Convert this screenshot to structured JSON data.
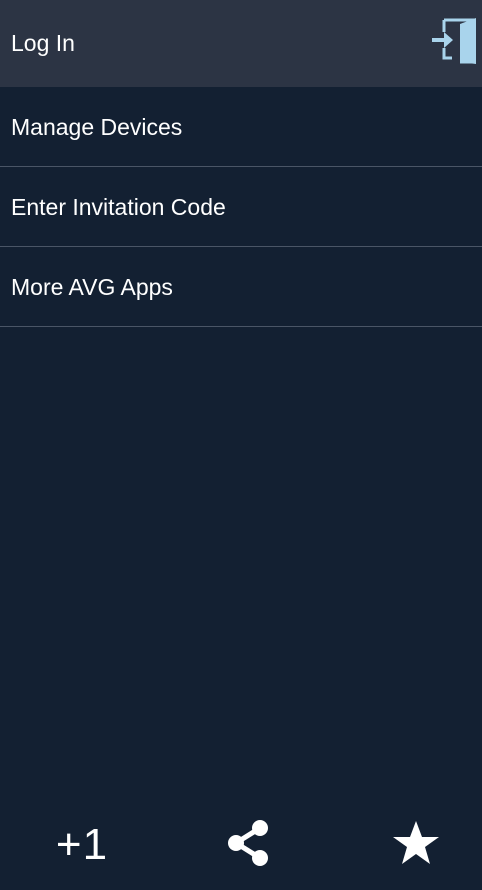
{
  "login": {
    "label": "Log In",
    "icon": "login-door-icon"
  },
  "menu": {
    "items": [
      {
        "label": "Manage Devices"
      },
      {
        "label": "Enter Invitation Code"
      },
      {
        "label": "More AVG Apps"
      }
    ]
  },
  "bottom_bar": {
    "plus_one_label": "+1",
    "share_icon": "share-icon",
    "star_icon": "star-icon"
  },
  "colors": {
    "background": "#132032",
    "header": "#2c3444",
    "divider": "#4a5566",
    "icon_accent": "#a9d4ec"
  }
}
